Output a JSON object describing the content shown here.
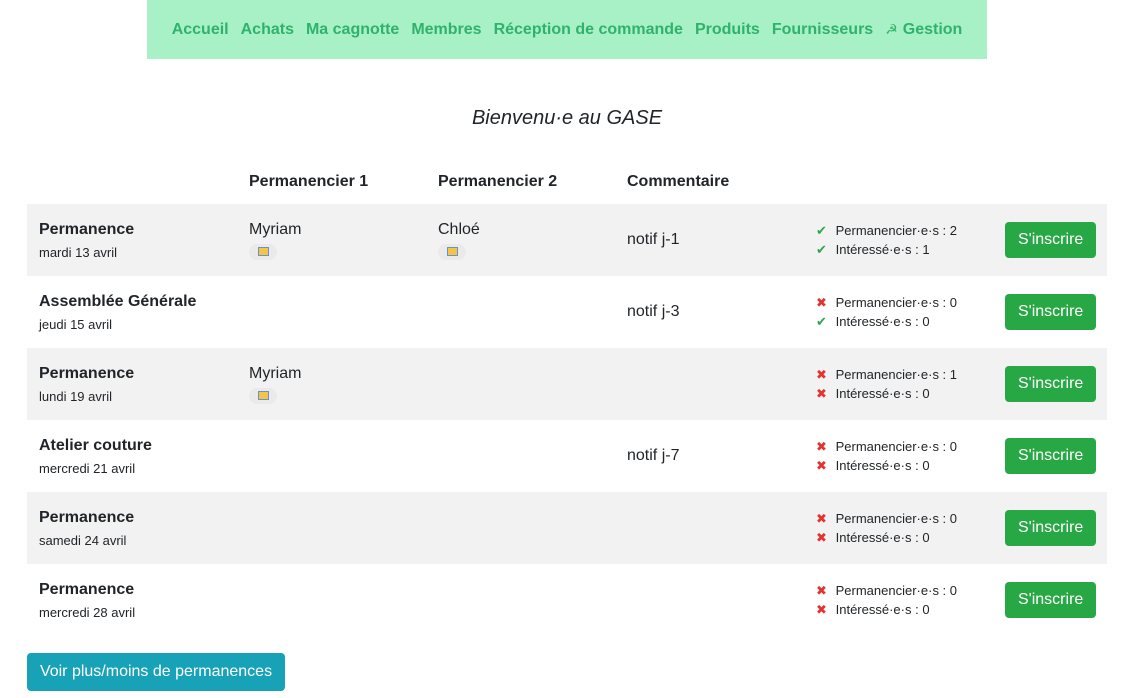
{
  "nav": {
    "items": [
      "Accueil",
      "Achats",
      "Ma cagnotte",
      "Membres",
      "Réception de commande",
      "Produits",
      "Fournisseurs"
    ],
    "gestion_icon": "☭",
    "gestion_label": "Gestion"
  },
  "title": "Bienvenu·e au GASE",
  "table": {
    "headers": [
      "",
      "Permanencier 1",
      "Permanencier 2",
      "Commentaire",
      "",
      ""
    ],
    "perm_label": "Permanencier·e·s : ",
    "int_label": "Intéressé·e·s : ",
    "rows": [
      {
        "event": "Permanence",
        "date": "mardi 13 avril",
        "perm1": "Myriam",
        "perm2": "Chloé",
        "comment": "notif j-1",
        "perm_ok": true,
        "perm_count": "2",
        "int_ok": true,
        "int_count": "1",
        "button": "S'inscrire"
      },
      {
        "event": "Assemblée Générale",
        "date": "jeudi 15 avril",
        "perm1": "",
        "perm2": "",
        "comment": "notif j-3",
        "perm_ok": false,
        "perm_count": "0",
        "int_ok": true,
        "int_count": "0",
        "button": "S'inscrire"
      },
      {
        "event": "Permanence",
        "date": "lundi 19 avril",
        "perm1": "Myriam",
        "perm2": "",
        "comment": "",
        "perm_ok": false,
        "perm_count": "1",
        "int_ok": false,
        "int_count": "0",
        "button": "S'inscrire"
      },
      {
        "event": "Atelier couture",
        "date": "mercredi 21 avril",
        "perm1": "",
        "perm2": "",
        "comment": "notif j-7",
        "perm_ok": false,
        "perm_count": "0",
        "int_ok": false,
        "int_count": "0",
        "button": "S'inscrire"
      },
      {
        "event": "Permanence",
        "date": "samedi 24 avril",
        "perm1": "",
        "perm2": "",
        "comment": "",
        "perm_ok": false,
        "perm_count": "0",
        "int_ok": false,
        "int_count": "0",
        "button": "S'inscrire"
      },
      {
        "event": "Permanence",
        "date": "mercredi 28 avril",
        "perm1": "",
        "perm2": "",
        "comment": "",
        "perm_ok": false,
        "perm_count": "0",
        "int_ok": false,
        "int_count": "0",
        "button": "S'inscrire"
      }
    ]
  },
  "more_button": "Voir plus/moins de permanences",
  "icons": {
    "ok": "check-mark-icon",
    "no": "cross-mark-icon",
    "badge": "id-card-icon"
  },
  "colors": {
    "nav_bg": "#a8f0c6",
    "nav_link": "#2fb36b",
    "primary_button": "#28a745",
    "info_button": "#17a2b8",
    "stripe": "#f2f2f2"
  }
}
